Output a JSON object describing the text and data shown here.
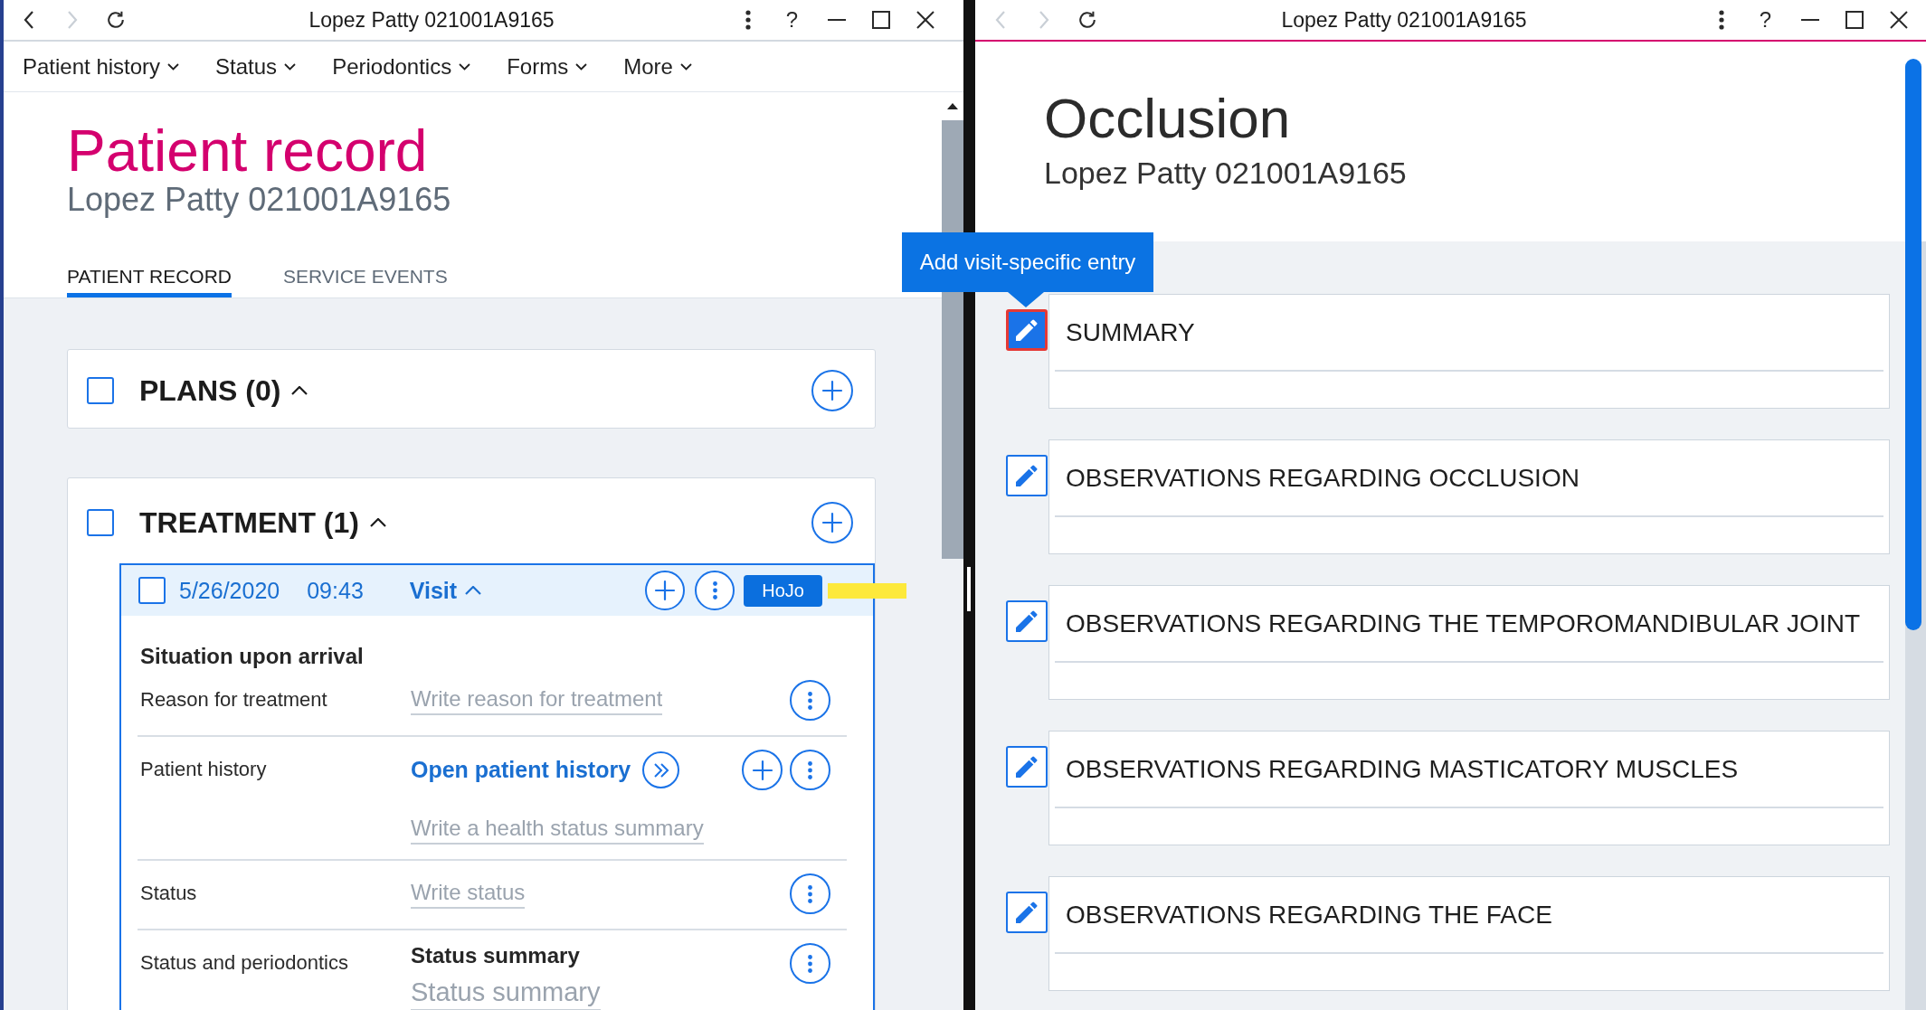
{
  "left_window": {
    "title_bar": {
      "title": "Lopez Patty 021001A9165",
      "active": false,
      "nav": [
        {
          "kind": "back",
          "disabled": false
        },
        {
          "kind": "forward",
          "disabled": true
        },
        {
          "kind": "refresh",
          "disabled": false
        }
      ],
      "help": "?"
    },
    "menu": [
      "Patient history",
      "Status",
      "Periodontics",
      "Forms",
      "More"
    ],
    "heading": "Patient record",
    "subtitle": "Lopez Patty 021001A9165",
    "tabs": [
      {
        "label": "PATIENT RECORD",
        "selected": true
      },
      {
        "label": "SERVICE EVENTS",
        "selected": false
      }
    ],
    "sections": [
      {
        "title": "PLANS (0)",
        "checked": false,
        "expanded": true
      },
      {
        "title": "TREATMENT (1)",
        "checked": false,
        "expanded": true,
        "visits": [
          {
            "checked": false,
            "date": "5/26/2020",
            "time": "09:43",
            "type": "Visit",
            "expanded": true,
            "badge": "HoJo",
            "highlighted": true,
            "heading": "Situation upon arrival",
            "rows": [
              {
                "label": "Reason for treatment",
                "content": [
                  {
                    "kind": "input",
                    "placeholder": "Write reason for treatment"
                  }
                ],
                "actions": [
                  {
                    "kind": "more"
                  }
                ]
              },
              {
                "label": "Patient history",
                "content": [
                  {
                    "kind": "link",
                    "text": "Open patient history"
                  },
                  {
                    "kind": "input",
                    "placeholder": "Write a health status summary"
                  }
                ],
                "actions": [
                  {
                    "kind": "add"
                  },
                  {
                    "kind": "more"
                  }
                ]
              },
              {
                "label": "Status",
                "content": [
                  {
                    "kind": "input",
                    "placeholder": "Write status"
                  }
                ],
                "actions": [
                  {
                    "kind": "more"
                  }
                ]
              },
              {
                "label": "Status and periodontics",
                "content": [
                  {
                    "kind": "subheading",
                    "text": "Status summary"
                  },
                  {
                    "kind": "large_input",
                    "placeholder": "Status summary"
                  }
                ],
                "actions": [
                  {
                    "kind": "more"
                  }
                ]
              }
            ]
          }
        ]
      }
    ]
  },
  "right_window": {
    "title_bar": {
      "title": "Lopez Patty 021001A9165",
      "active": true,
      "nav": [
        {
          "kind": "back",
          "disabled": true
        },
        {
          "kind": "forward",
          "disabled": true
        },
        {
          "kind": "refresh",
          "disabled": false
        }
      ],
      "help": "?"
    },
    "heading": "Occlusion",
    "subtitle": "Lopez Patty 021001A9165",
    "tooltip": "Add visit-specific entry",
    "sections": [
      {
        "title": "SUMMARY",
        "focused": true
      },
      {
        "title": "OBSERVATIONS REGARDING OCCLUSION",
        "focused": false
      },
      {
        "title": "OBSERVATIONS REGARDING THE TEMPOROMANDIBULAR JOINT",
        "focused": false
      },
      {
        "title": "OBSERVATIONS REGARDING MASTICATORY MUSCLES",
        "focused": false
      },
      {
        "title": "OBSERVATIONS REGARDING THE FACE",
        "focused": false
      }
    ]
  }
}
